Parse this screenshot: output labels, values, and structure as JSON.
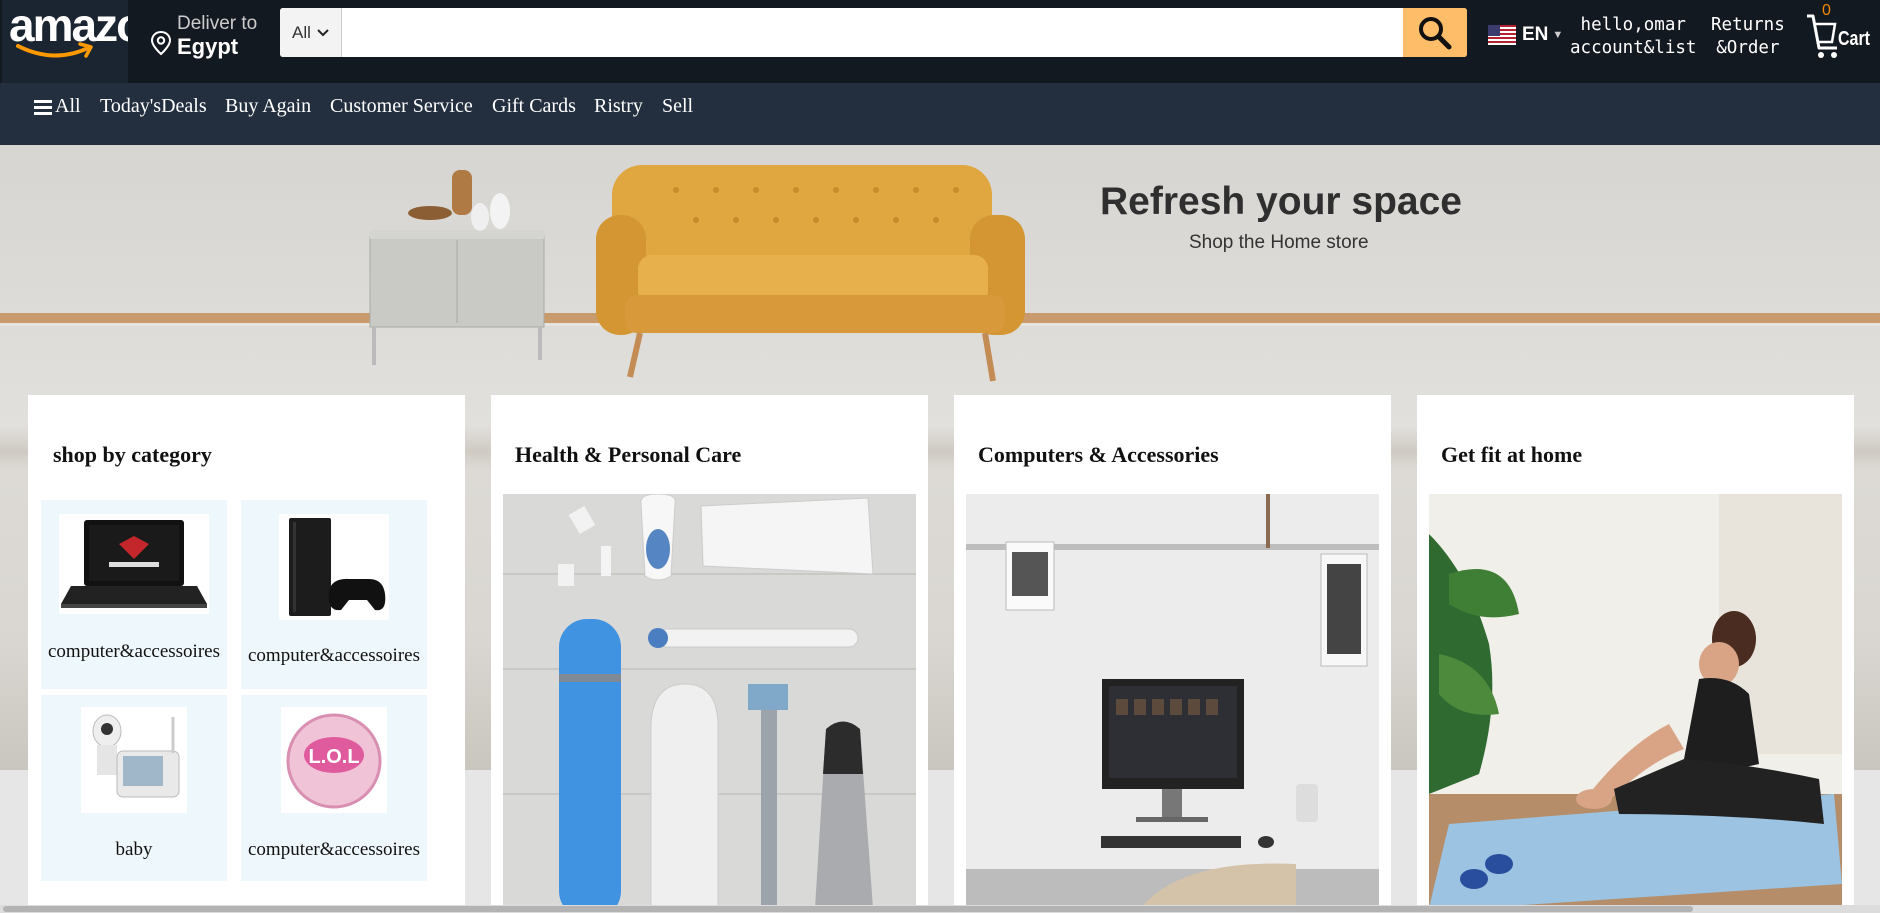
{
  "header": {
    "logo_text": "amazon",
    "deliver_label": "Deliver to",
    "deliver_location": "Egypt",
    "search_category": "All",
    "search_placeholder": "",
    "language": "EN",
    "account_line1": "hello,omar",
    "account_line2": "account&list",
    "returns_line1": "Returns",
    "returns_line2": "&Order",
    "cart_count": "0",
    "cart_label": "Cart"
  },
  "nav": {
    "items": [
      "All",
      "Today'sDeals",
      "Buy Again",
      "Customer Service",
      "Gift Cards",
      "Ristry",
      "Sell"
    ]
  },
  "hero": {
    "title": "Refresh your space",
    "subtitle": "Shop the Home store"
  },
  "cards": [
    {
      "title": "shop by category",
      "tiles": [
        {
          "label": "computer&accessoires",
          "image": "laptop"
        },
        {
          "label": "computer&accessoires",
          "image": "game-console"
        },
        {
          "label": "baby",
          "image": "baby-monitor"
        },
        {
          "label": "computer&accessoires",
          "image": "toy-ball"
        }
      ]
    },
    {
      "title": "Health & Personal Care",
      "image": "personal-care-products"
    },
    {
      "title": "Computers & Accessories",
      "image": "desktop-computer"
    },
    {
      "title": "Get fit at home",
      "image": "woman-stretching"
    }
  ],
  "colors": {
    "topbar": "#131921",
    "navbar": "#232f3e",
    "search_button": "#febd69",
    "cart_count": "#f08804"
  }
}
